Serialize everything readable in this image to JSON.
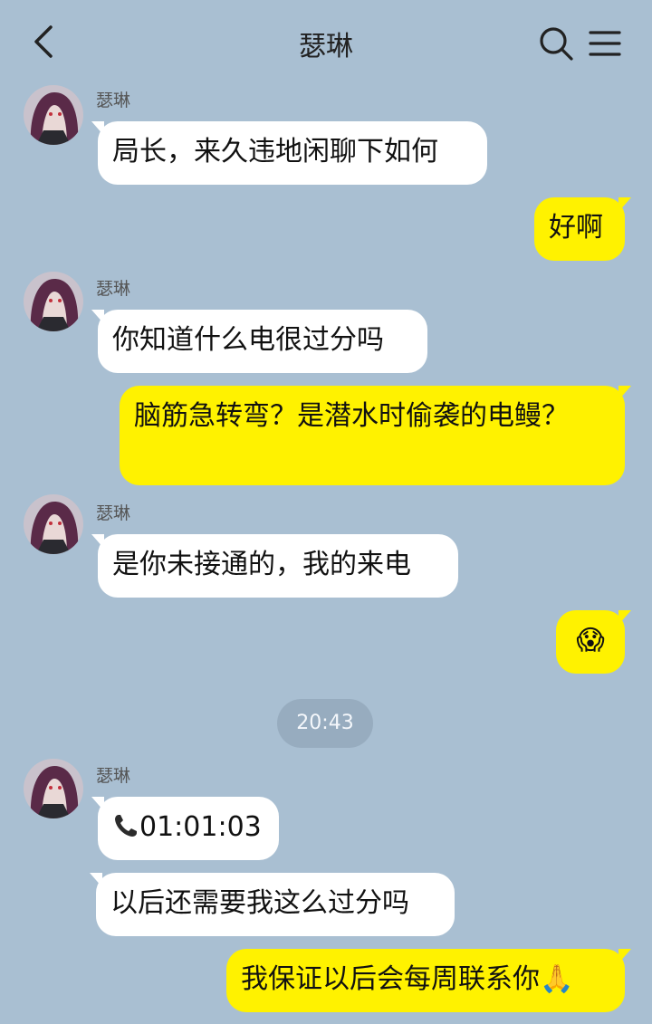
{
  "header": {
    "title": "瑟琳",
    "back_icon": "chevron-left-icon",
    "search_icon": "search-icon",
    "menu_icon": "menu-icon"
  },
  "colors": {
    "background": "#a9bfd2",
    "incoming_bubble": "#ffffff",
    "outgoing_bubble": "#fff200",
    "time_pill": "#97acbf"
  },
  "contact": {
    "name": "瑟琳"
  },
  "messages": [
    {
      "direction": "incoming",
      "sender": "瑟琳",
      "text": "局长，来久违地闲聊下如何"
    },
    {
      "direction": "outgoing",
      "text": "好啊"
    },
    {
      "direction": "incoming",
      "sender": "瑟琳",
      "text": "你知道什么电很过分吗"
    },
    {
      "direction": "outgoing",
      "text": "脑筋急转弯？是潜水时偷袭的电鳗？"
    },
    {
      "direction": "incoming",
      "sender": "瑟琳",
      "text": "是你未接通的，我的来电"
    },
    {
      "direction": "outgoing",
      "text": "😱"
    },
    {
      "type": "timestamp",
      "text": "20:43"
    },
    {
      "direction": "incoming",
      "sender": "瑟琳",
      "icon": "phone-icon",
      "text": "01:01:03"
    },
    {
      "direction": "incoming",
      "text": "以后还需要我这么过分吗"
    },
    {
      "direction": "outgoing",
      "text": "我保证以后会每周联系你🙏"
    }
  ]
}
